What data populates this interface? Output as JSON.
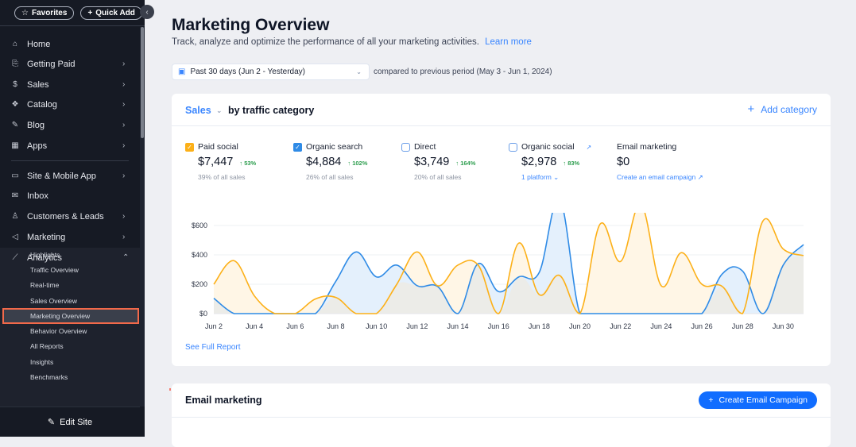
{
  "sidebar": {
    "favorites_label": "Favorites",
    "quick_add_label": "Quick Add",
    "items": [
      {
        "label": "Home",
        "icon": "home-icon",
        "glyph": "⌂",
        "chevron": false
      },
      {
        "label": "Getting Paid",
        "icon": "invoice-icon",
        "glyph": "⎘",
        "chevron": true
      },
      {
        "label": "Sales",
        "icon": "dollar-circle-icon",
        "glyph": "$",
        "chevron": true
      },
      {
        "label": "Catalog",
        "icon": "catalog-icon",
        "glyph": "❖",
        "chevron": true
      },
      {
        "label": "Blog",
        "icon": "blog-pen-icon",
        "glyph": "✎",
        "chevron": true
      },
      {
        "label": "Apps",
        "icon": "apps-icon",
        "glyph": "▦",
        "chevron": true
      },
      {
        "label": "Site & Mobile App",
        "icon": "devices-icon",
        "glyph": "▭",
        "chevron": true
      },
      {
        "label": "Inbox",
        "icon": "inbox-icon",
        "glyph": "✉",
        "chevron": false
      },
      {
        "label": "Customers & Leads",
        "icon": "customers-icon",
        "glyph": "♙",
        "chevron": true
      },
      {
        "label": "Marketing",
        "icon": "megaphone-icon",
        "glyph": "◁",
        "chevron": true
      },
      {
        "label": "Analytics",
        "icon": "analytics-chart-icon",
        "glyph": "⟋",
        "chevron": "up"
      }
    ],
    "analytics_sub": [
      "Highlights",
      "Traffic Overview",
      "Real-time",
      "Sales Overview",
      "Marketing Overview",
      "Behavior Overview",
      "All Reports",
      "Insights",
      "Benchmarks"
    ],
    "active_sub": "Marketing Overview",
    "edit_site_label": "Edit Site"
  },
  "header": {
    "title": "Marketing Overview",
    "subtitle": "Track, analyze and optimize the performance of all your marketing activities.",
    "learn_more": "Learn more",
    "date_range": "Past 30 days (Jun 2 - Yesterday)",
    "compare_text": "compared to previous period (May 3 - Jun 1, 2024)"
  },
  "sales_card": {
    "metric": "Sales",
    "by_label": "by traffic category",
    "add_category": "Add category",
    "see_full_report": "See Full Report",
    "categories": [
      {
        "name": "Paid social",
        "value": "$7,447",
        "change": "53%",
        "share": "39% of all sales",
        "checked": true,
        "color": "#fcb018"
      },
      {
        "name": "Organic search",
        "value": "$4,884",
        "change": "102%",
        "share": "26% of all sales",
        "checked": true,
        "color": "#2f8be6"
      },
      {
        "name": "Direct",
        "value": "$3,749",
        "change": "164%",
        "share": "20% of all sales",
        "checked": false
      },
      {
        "name": "Organic social",
        "value": "$2,978",
        "change": "83%",
        "link": "1 platform",
        "checked": false
      },
      {
        "name": "Email marketing",
        "value": "$0",
        "link": "Create an email campaign"
      }
    ]
  },
  "email_card": {
    "title": "Email marketing",
    "cta": "Create Email Campaign"
  },
  "chart_data": {
    "type": "area",
    "title": "Sales by traffic category",
    "xlabel": "",
    "ylabel": "",
    "ylim": [
      0,
      800
    ],
    "yticks": [
      0,
      200,
      400,
      600
    ],
    "ytick_labels": [
      "$0",
      "$200",
      "$400",
      "$600"
    ],
    "x": [
      "Jun 2",
      "Jun 3",
      "Jun 4",
      "Jun 5",
      "Jun 6",
      "Jun 7",
      "Jun 8",
      "Jun 9",
      "Jun 10",
      "Jun 11",
      "Jun 12",
      "Jun 13",
      "Jun 14",
      "Jun 15",
      "Jun 16",
      "Jun 17",
      "Jun 18",
      "Jun 19",
      "Jun 20",
      "Jun 21",
      "Jun 22",
      "Jun 23",
      "Jun 24",
      "Jun 25",
      "Jun 26",
      "Jun 27",
      "Jun 28",
      "Jun 29",
      "Jun 30",
      "Jul 1"
    ],
    "xtick_labels": [
      "Jun 2",
      "Jun 4",
      "Jun 6",
      "Jun 8",
      "Jun 10",
      "Jun 12",
      "Jun 14",
      "Jun 16",
      "Jun 18",
      "Jun 20",
      "Jun 22",
      "Jun 24",
      "Jun 26",
      "Jun 28",
      "Jun 30"
    ],
    "grid": true,
    "series": [
      {
        "name": "Paid social",
        "color": "#fcb018",
        "fill": "#fff6e6",
        "values": [
          200,
          360,
          120,
          0,
          0,
          100,
          110,
          0,
          0,
          200,
          420,
          190,
          330,
          330,
          0,
          480,
          130,
          260,
          0,
          610,
          355,
          745,
          190,
          415,
          200,
          185,
          0,
          630,
          440,
          395
        ]
      },
      {
        "name": "Organic search",
        "color": "#2f8be6",
        "fill": "#e4f0fc",
        "values": [
          105,
          0,
          0,
          0,
          0,
          0,
          220,
          420,
          250,
          330,
          190,
          185,
          0,
          340,
          150,
          250,
          280,
          780,
          0,
          0,
          0,
          0,
          0,
          0,
          0,
          270,
          290,
          0,
          330,
          470
        ]
      }
    ]
  }
}
